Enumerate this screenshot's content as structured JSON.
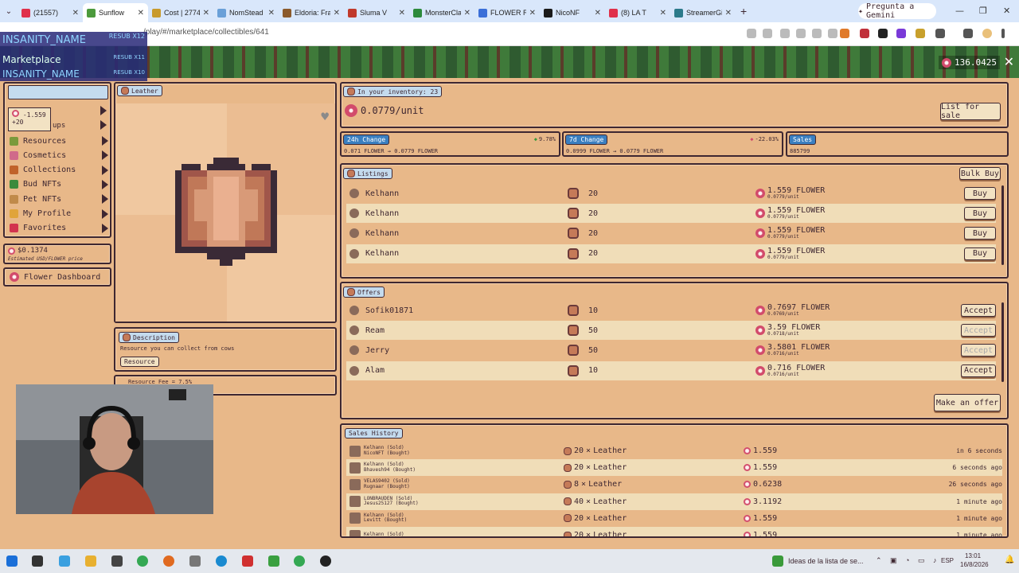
{
  "browser": {
    "tabs": [
      {
        "title": "(21557)",
        "color": "#e0304a"
      },
      {
        "title": "Sunflow",
        "color": "#4c9a3c",
        "active": true
      },
      {
        "title": "Cost | 2774",
        "color": "#c89a2c"
      },
      {
        "title": "NomStead",
        "color": "#6aa0d8"
      },
      {
        "title": "Eldoria: Fra",
        "color": "#8b5a2b"
      },
      {
        "title": "Sluma V",
        "color": "#c0392b"
      },
      {
        "title": "MonsterCla",
        "color": "#2c8a3c"
      },
      {
        "title": "FLOWER Re",
        "color": "#3b6fd8"
      },
      {
        "title": "NicoNF",
        "color": "#1a1a1a"
      },
      {
        "title": "(8) LA T",
        "color": "#e0304a"
      },
      {
        "title": "StreamerGi",
        "color": "#2c7a8a"
      }
    ],
    "gemini_label": "Pregunta a Gemini",
    "url": "/play/#/marketplace/collectibles/641"
  },
  "overlay": {
    "name1": "INSANITY_NAME",
    "resub1": "RESUB X12",
    "name2": "INSANITY_NAME",
    "resub2": "RESUB X11",
    "name3": "INSANITY_NAME",
    "resub3": "RESUB X10",
    "title": "Marketplace"
  },
  "game": {
    "coin_balance": "136.0425",
    "sidebar": {
      "notif_value": "-1.559",
      "notif_sub": "+20",
      "partial_label": "ups",
      "items": [
        {
          "label": "Resources",
          "color": "#7a9a3c"
        },
        {
          "label": "Cosmetics",
          "color": "#d06a8a"
        },
        {
          "label": "Collections",
          "color": "#c0622a"
        },
        {
          "label": "Bud NFTs",
          "color": "#3c8a3c"
        },
        {
          "label": "Pet NFTs",
          "color": "#c08a4a"
        },
        {
          "label": "My Profile",
          "color": "#e0a43a"
        },
        {
          "label": "Favorites",
          "color": "#d2344e"
        }
      ]
    },
    "price": {
      "value": "$0.1374",
      "sub": "Estimated USD/FLOWER price"
    },
    "dashboard_label": "Flower Dashboard",
    "item": {
      "name": "Leather",
      "desc_title": "Description",
      "description": "Resource you can collect from cows",
      "tag": "Resource",
      "fee": "Resource Fee = 7.5%"
    },
    "inventory": {
      "label": "In your inventory: 23",
      "unit_price": "0.0779/unit",
      "list_button": "List for sale"
    },
    "stats": [
      {
        "title": "24h Change",
        "pct": "9.78%",
        "range": "0.071 FLOWER → 0.0779 FLOWER",
        "trend": "up"
      },
      {
        "title": "7d Change",
        "pct": "-22.03%",
        "range": "0.0999 FLOWER → 0.0779 FLOWER",
        "trend": "down"
      },
      {
        "title": "Sales",
        "pct": "",
        "range": "885799",
        "trend": ""
      }
    ],
    "listings": {
      "label": "Listings",
      "bulk_button": "Bulk Buy",
      "rows": [
        {
          "user": "Kelhann",
          "qty": "20",
          "price": "1.559 FLOWER",
          "unit": "0.0779/unit",
          "action": "Buy"
        },
        {
          "user": "Kelhann",
          "qty": "20",
          "price": "1.559 FLOWER",
          "unit": "0.0779/unit",
          "action": "Buy"
        },
        {
          "user": "Kelhann",
          "qty": "20",
          "price": "1.559 FLOWER",
          "unit": "0.0779/unit",
          "action": "Buy"
        },
        {
          "user": "Kelhann",
          "qty": "20",
          "price": "1.559 FLOWER",
          "unit": "0.0779/unit",
          "action": "Buy"
        }
      ]
    },
    "offers": {
      "label": "Offers",
      "make_button": "Make an offer",
      "rows": [
        {
          "user": "Sofik01871",
          "qty": "10",
          "price": "0.7697 FLOWER",
          "unit": "0.0769/unit",
          "action": "Accept"
        },
        {
          "user": "Ream",
          "qty": "50",
          "price": "3.59 FLOWER",
          "unit": "0.0718/unit",
          "action": "Accept"
        },
        {
          "user": "Jerry",
          "qty": "50",
          "price": "3.5801 FLOWER",
          "unit": "0.0716/unit",
          "action": "Accept"
        },
        {
          "user": "Alam",
          "qty": "10",
          "price": "0.716 FLOWER",
          "unit": "0.0716/unit",
          "action": "Accept"
        }
      ]
    },
    "history": {
      "label": "Sales History",
      "rows": [
        {
          "seller": "Kelhann (Sold)",
          "buyer": "NicoNFT (Bought)",
          "qty": "20",
          "item": "Leather",
          "price": "1.559",
          "time": "in 6 seconds"
        },
        {
          "seller": "Kelhann (Sold)",
          "buyer": "Bhavesh94 (Bought)",
          "qty": "20",
          "item": "Leather",
          "price": "1.559",
          "time": "6 seconds ago"
        },
        {
          "seller": "VELAS9402 (Sold)",
          "buyer": "Rugnaar (Bought)",
          "qty": "8",
          "item": "Leather",
          "price": "0.6238",
          "time": "26 seconds ago"
        },
        {
          "seller": "LONBRAUDEN (Sold)",
          "buyer": "Jesus25127 (Bought)",
          "qty": "40",
          "item": "Leather",
          "price": "3.1192",
          "time": "1 minute ago"
        },
        {
          "seller": "Kelhann (Sold)",
          "buyer": "Levitt (Bought)",
          "qty": "20",
          "item": "Leather",
          "price": "1.559",
          "time": "1 minute ago"
        },
        {
          "seller": "Kelhann (Sold)",
          "buyer": "",
          "qty": "20",
          "item": "Leather",
          "price": "1.559",
          "time": "1 minute ago"
        }
      ]
    }
  },
  "taskbar": {
    "news": "Ideas de la lista de se...",
    "lang": "ESP",
    "time": "13:01",
    "date": "16/8/2026"
  }
}
